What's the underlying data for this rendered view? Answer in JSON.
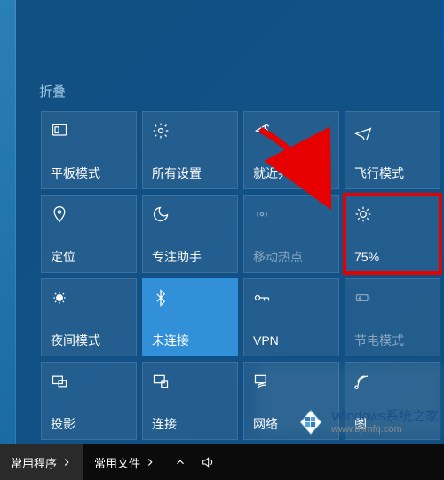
{
  "collapse_label": "折叠",
  "tiles": [
    {
      "id": "tablet-mode",
      "label": "平板模式",
      "icon": "tablet",
      "state": "normal"
    },
    {
      "id": "all-settings",
      "label": "所有设置",
      "icon": "gear",
      "state": "normal"
    },
    {
      "id": "nearby-share",
      "label": "就近共享",
      "icon": "share",
      "state": "normal"
    },
    {
      "id": "airplane-mode",
      "label": "飞行模式",
      "icon": "airplane",
      "state": "normal"
    },
    {
      "id": "location",
      "label": "定位",
      "icon": "location",
      "state": "normal"
    },
    {
      "id": "focus-assist",
      "label": "专注助手",
      "icon": "moon",
      "state": "normal"
    },
    {
      "id": "mobile-hotspot",
      "label": "移动热点",
      "icon": "hotspot",
      "state": "disabled"
    },
    {
      "id": "brightness",
      "label": "75%",
      "icon": "sun",
      "state": "highlighted"
    },
    {
      "id": "night-light",
      "label": "夜间模式",
      "icon": "nightlight",
      "state": "normal"
    },
    {
      "id": "bluetooth",
      "label": "未连接",
      "icon": "bluetooth",
      "state": "active-blue"
    },
    {
      "id": "vpn",
      "label": "VPN",
      "icon": "vpn",
      "state": "normal"
    },
    {
      "id": "battery-saver",
      "label": "节电模式",
      "icon": "battery",
      "state": "disabled"
    },
    {
      "id": "project",
      "label": "投影",
      "icon": "project",
      "state": "normal"
    },
    {
      "id": "connect",
      "label": "连接",
      "icon": "connect",
      "state": "normal"
    },
    {
      "id": "network",
      "label": "网络",
      "icon": "network",
      "state": "normal"
    },
    {
      "id": "screenshot",
      "label": "图",
      "icon": "clip",
      "state": "normal"
    }
  ],
  "taskbar": {
    "items": [
      "常用程序",
      "常用文件"
    ],
    "tray": [
      "chevron-up",
      "volume"
    ]
  },
  "watermark": {
    "title": "Windows系统之家",
    "subtitle": "www.bjlmfq.com"
  },
  "colors": {
    "highlight_border": "#e60000",
    "active_tile": "#3190d8"
  }
}
